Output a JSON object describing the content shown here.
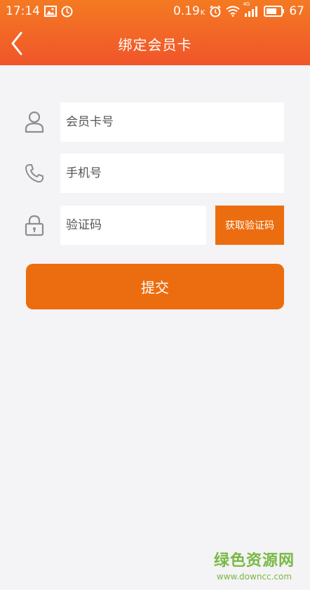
{
  "status_bar": {
    "time": "17:14",
    "speed": "0.19",
    "speed_unit": "K",
    "network_label": "4G",
    "battery": "67"
  },
  "header": {
    "title": "绑定会员卡"
  },
  "form": {
    "card_number": {
      "placeholder": "会员卡号",
      "value": ""
    },
    "phone": {
      "placeholder": "手机号",
      "value": ""
    },
    "code": {
      "placeholder": "验证码",
      "value": ""
    },
    "get_code_label": "获取验证码",
    "submit_label": "提交"
  },
  "watermark": {
    "title": "绿色资源网",
    "url": "www.downcc.com"
  },
  "colors": {
    "accent": "#ec6d0f",
    "header_top": "#f47a22",
    "header_bottom": "#f0552a",
    "background": "#f4f3f5",
    "watermark": "#78b943"
  },
  "icons": {
    "back": "chevron-left-icon",
    "card_number": "user-icon",
    "phone": "phone-icon",
    "code": "lock-icon"
  }
}
